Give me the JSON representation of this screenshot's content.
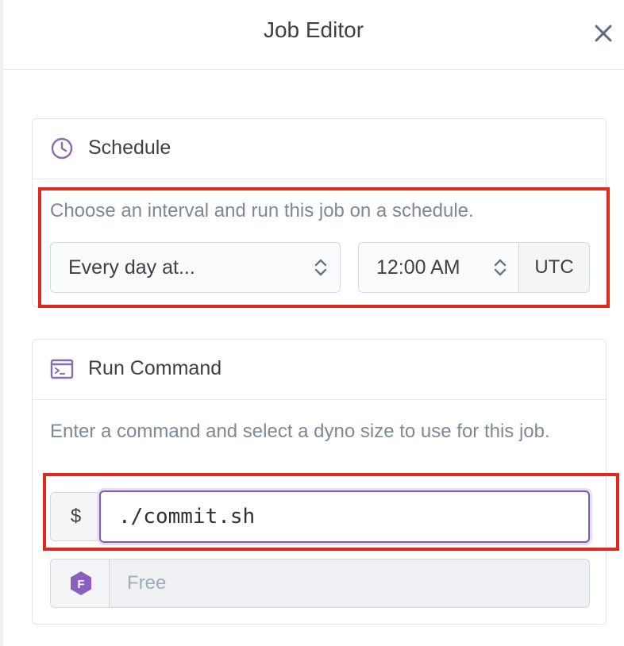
{
  "header": {
    "title": "Job Editor",
    "close_icon": "close-icon"
  },
  "schedule": {
    "title": "Schedule",
    "icon": "clock-icon",
    "help": "Choose an interval and run this job on a schedule.",
    "interval_value": "Every day at...",
    "time_value": "12:00 AM",
    "timezone": "UTC"
  },
  "command": {
    "title": "Run Command",
    "icon": "terminal-icon",
    "help": "Enter a command and select a dyno size to use for this job.",
    "prompt": "$",
    "value": "./commit.sh",
    "dyno_badge": "F",
    "dyno_size": "Free"
  },
  "colors": {
    "accent": "#7f5ea8",
    "highlight": "#e2281e",
    "muted_text": "#7d8899"
  }
}
